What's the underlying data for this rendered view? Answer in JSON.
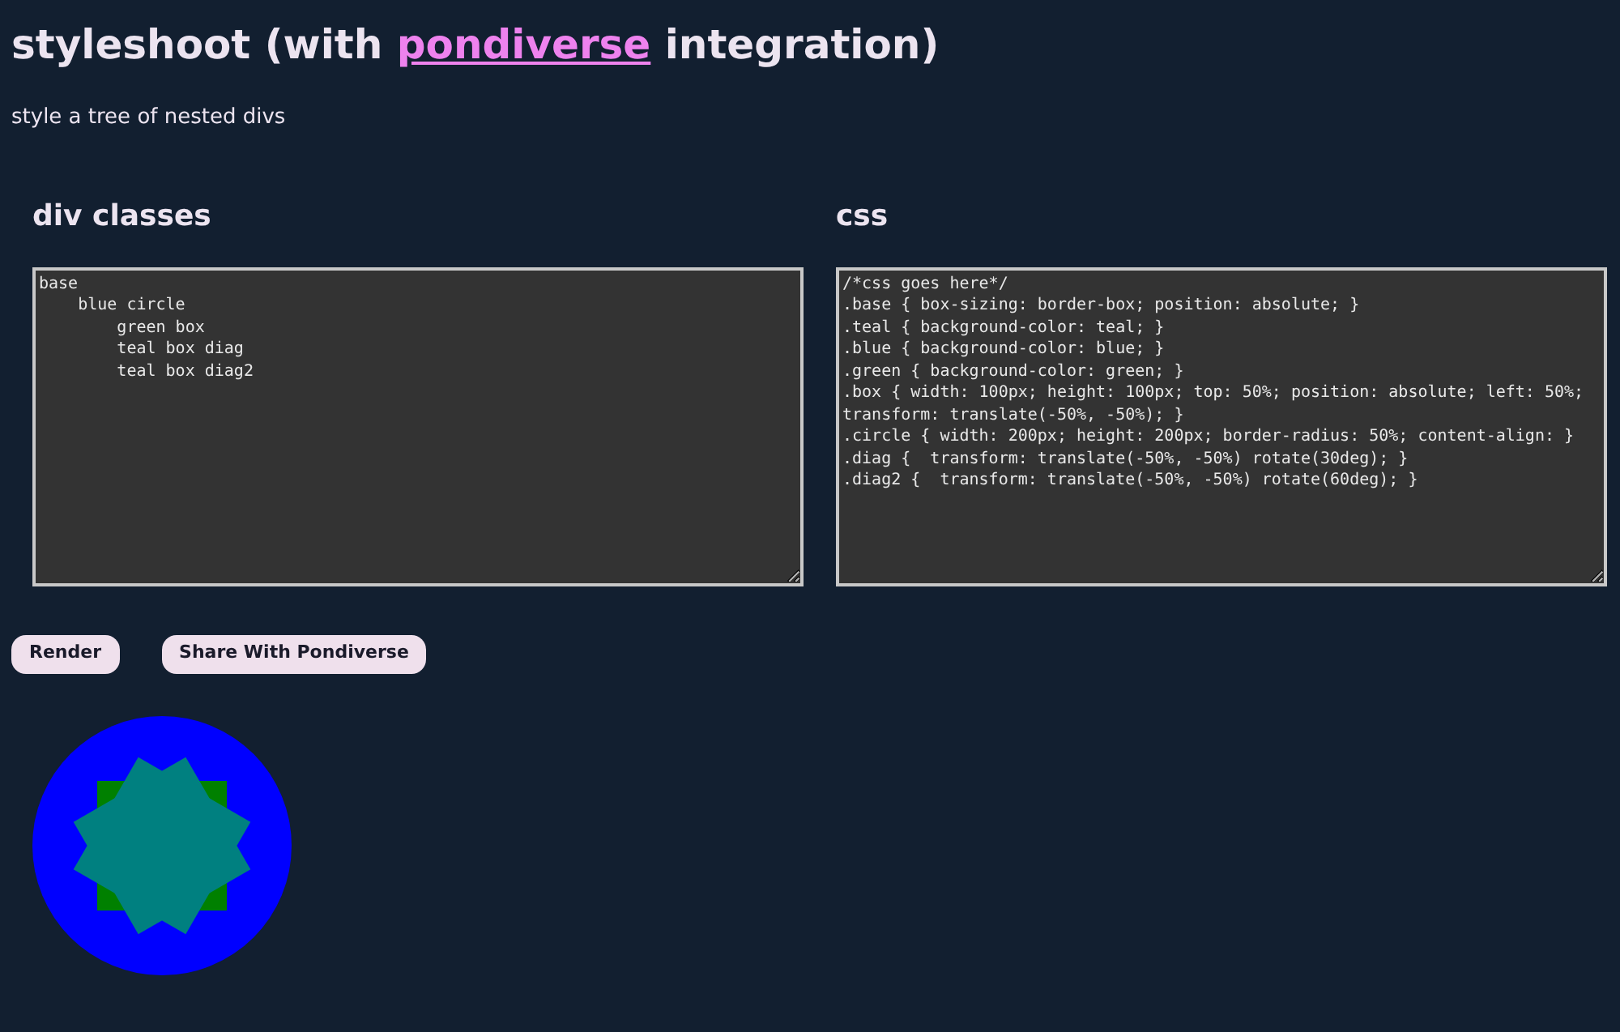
{
  "title": {
    "before": "styleshoot (with ",
    "link": "pondiverse",
    "after": " integration)"
  },
  "subtitle": "style a tree of nested divs",
  "panels": [
    {
      "heading": "div classes",
      "content": "base\n    blue circle\n        green box\n        teal box diag\n        teal box diag2"
    },
    {
      "heading": "css",
      "content": "/*css goes here*/\n.base { box-sizing: border-box; position: absolute; }\n.teal { background-color: teal; }\n.blue { background-color: blue; }\n.green { background-color: green; }\n.box { width: 100px; height: 100px; top: 50%; position: absolute; left: 50%; transform: translate(-50%, -50%); }\n.circle { width: 200px; height: 200px; border-radius: 50%; content-align: }\n.diag {  transform: translate(-50%, -50%) rotate(30deg); }\n.diag2 {  transform: translate(-50%, -50%) rotate(60deg); }"
    }
  ],
  "buttons": [
    "Render",
    "Share With Pondiverse"
  ]
}
